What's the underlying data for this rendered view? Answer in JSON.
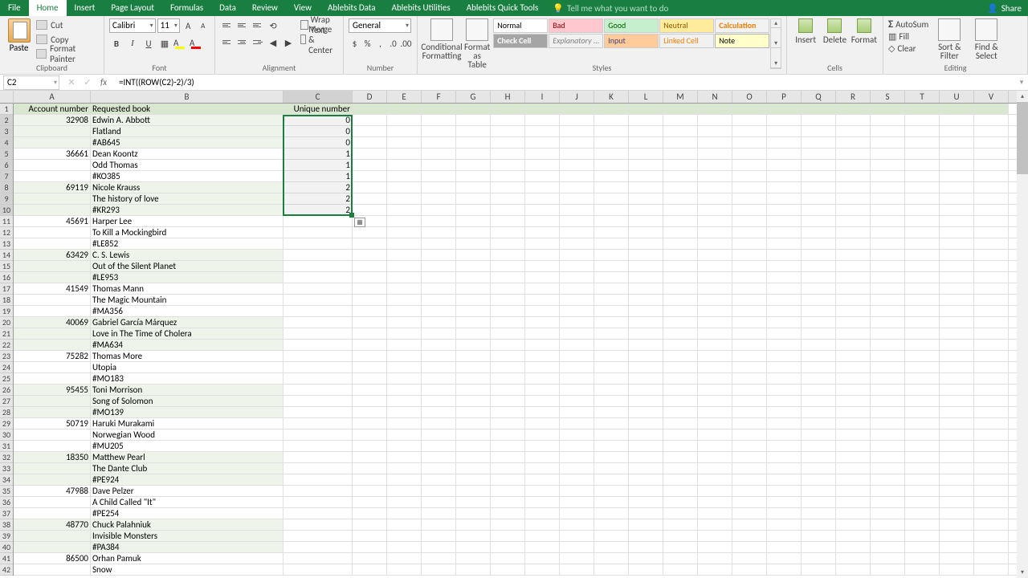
{
  "titlebar": {
    "tabs": [
      "File",
      "Home",
      "Insert",
      "Page Layout",
      "Formulas",
      "Data",
      "Review",
      "View",
      "Ablebits Data",
      "Ablebits Utilities",
      "Ablebits Quick Tools"
    ],
    "active_tab": "Home",
    "tellme": "Tell me what you want to do",
    "share": "Share"
  },
  "ribbon": {
    "clipboard": {
      "label": "Clipboard",
      "paste": "Paste",
      "cut": "Cut",
      "copy": "Copy",
      "format_painter": "Format Painter"
    },
    "font": {
      "label": "Font",
      "name": "Calibri",
      "size": "11"
    },
    "alignment": {
      "label": "Alignment",
      "wrap": "Wrap Text",
      "merge": "Merge & Center"
    },
    "number": {
      "label": "Number",
      "format": "General"
    },
    "styles": {
      "label": "Styles",
      "conditional": "Conditional Formatting",
      "format_table": "Format as Table",
      "gallery": [
        "Normal",
        "Bad",
        "Good",
        "Neutral",
        "Calculation",
        "Check Cell",
        "Explanatory ...",
        "Input",
        "Linked Cell",
        "Note"
      ]
    },
    "cells": {
      "label": "Cells",
      "insert": "Insert",
      "delete": "Delete",
      "format": "Format"
    },
    "editing": {
      "label": "Editing",
      "autosum": "AutoSum",
      "fill": "Fill",
      "clear": "Clear",
      "sort": "Sort & Filter",
      "find": "Find & Select"
    }
  },
  "formula_bar": {
    "name_box": "C2",
    "formula": "=INT((ROW(C2)-2)/3)"
  },
  "columns": [
    "A",
    "B",
    "C",
    "D",
    "E",
    "F",
    "G",
    "H",
    "I",
    "J",
    "K",
    "L",
    "M",
    "N",
    "O",
    "P",
    "Q",
    "R",
    "S",
    "T",
    "U",
    "V"
  ],
  "col_widths": {
    "A": 96,
    "B": 240,
    "C": 86,
    "rest": 43
  },
  "selection": {
    "range": "C2:C10"
  },
  "sheet": {
    "headers": {
      "A": "Account number",
      "B": "Requested book",
      "C": "Unique number"
    },
    "rows": [
      {
        "n": 2,
        "a": "32908",
        "b": "Edwin A. Abbott",
        "c": "0"
      },
      {
        "n": 3,
        "a": "",
        "b": "Flatland",
        "c": "0"
      },
      {
        "n": 4,
        "a": "",
        "b": "#AB645",
        "c": "0"
      },
      {
        "n": 5,
        "a": "36661",
        "b": "Dean Koontz",
        "c": "1"
      },
      {
        "n": 6,
        "a": "",
        "b": "Odd Thomas",
        "c": "1"
      },
      {
        "n": 7,
        "a": "",
        "b": "#KO385",
        "c": "1"
      },
      {
        "n": 8,
        "a": "69119",
        "b": "Nicole Krauss",
        "c": "2"
      },
      {
        "n": 9,
        "a": "",
        "b": "The history of love",
        "c": "2"
      },
      {
        "n": 10,
        "a": "",
        "b": "#KR293",
        "c": "2"
      },
      {
        "n": 11,
        "a": "45691",
        "b": "Harper Lee",
        "c": ""
      },
      {
        "n": 12,
        "a": "",
        "b": "To Kill a Mockingbird",
        "c": ""
      },
      {
        "n": 13,
        "a": "",
        "b": "#LE852",
        "c": ""
      },
      {
        "n": 14,
        "a": "63429",
        "b": "C. S. Lewis",
        "c": ""
      },
      {
        "n": 15,
        "a": "",
        "b": "Out of the Silent Planet",
        "c": ""
      },
      {
        "n": 16,
        "a": "",
        "b": "#LE953",
        "c": ""
      },
      {
        "n": 17,
        "a": "41549",
        "b": "Thomas Mann",
        "c": ""
      },
      {
        "n": 18,
        "a": "",
        "b": "The Magic Mountain",
        "c": ""
      },
      {
        "n": 19,
        "a": "",
        "b": "#MA356",
        "c": ""
      },
      {
        "n": 20,
        "a": "40069",
        "b": "Gabriel García Márquez",
        "c": ""
      },
      {
        "n": 21,
        "a": "",
        "b": "Love in The Time of Cholera",
        "c": ""
      },
      {
        "n": 22,
        "a": "",
        "b": "#MA634",
        "c": ""
      },
      {
        "n": 23,
        "a": "75282",
        "b": "Thomas More",
        "c": ""
      },
      {
        "n": 24,
        "a": "",
        "b": "Utopia",
        "c": ""
      },
      {
        "n": 25,
        "a": "",
        "b": "#MO183",
        "c": ""
      },
      {
        "n": 26,
        "a": "95455",
        "b": "Toni Morrison",
        "c": ""
      },
      {
        "n": 27,
        "a": "",
        "b": "Song of Solomon",
        "c": ""
      },
      {
        "n": 28,
        "a": "",
        "b": "#MO139",
        "c": ""
      },
      {
        "n": 29,
        "a": "50719",
        "b": "Haruki Murakami",
        "c": ""
      },
      {
        "n": 30,
        "a": "",
        "b": "Norwegian Wood",
        "c": ""
      },
      {
        "n": 31,
        "a": "",
        "b": "#MU205",
        "c": ""
      },
      {
        "n": 32,
        "a": "18350",
        "b": "Matthew Pearl",
        "c": ""
      },
      {
        "n": 33,
        "a": "",
        "b": "The Dante Club",
        "c": ""
      },
      {
        "n": 34,
        "a": "",
        "b": "#PE924",
        "c": ""
      },
      {
        "n": 35,
        "a": "47988",
        "b": "Dave Pelzer",
        "c": ""
      },
      {
        "n": 36,
        "a": "",
        "b": "A Child Called \"It\"",
        "c": ""
      },
      {
        "n": 37,
        "a": "",
        "b": "#PE254",
        "c": ""
      },
      {
        "n": 38,
        "a": "48770",
        "b": "Chuck Palahniuk",
        "c": ""
      },
      {
        "n": 39,
        "a": "",
        "b": "Invisible Monsters",
        "c": ""
      },
      {
        "n": 40,
        "a": "",
        "b": "#PA384",
        "c": ""
      },
      {
        "n": 41,
        "a": "86500",
        "b": "Orhan Pamuk",
        "c": ""
      },
      {
        "n": 42,
        "a": "",
        "b": "Snow",
        "c": ""
      }
    ]
  }
}
